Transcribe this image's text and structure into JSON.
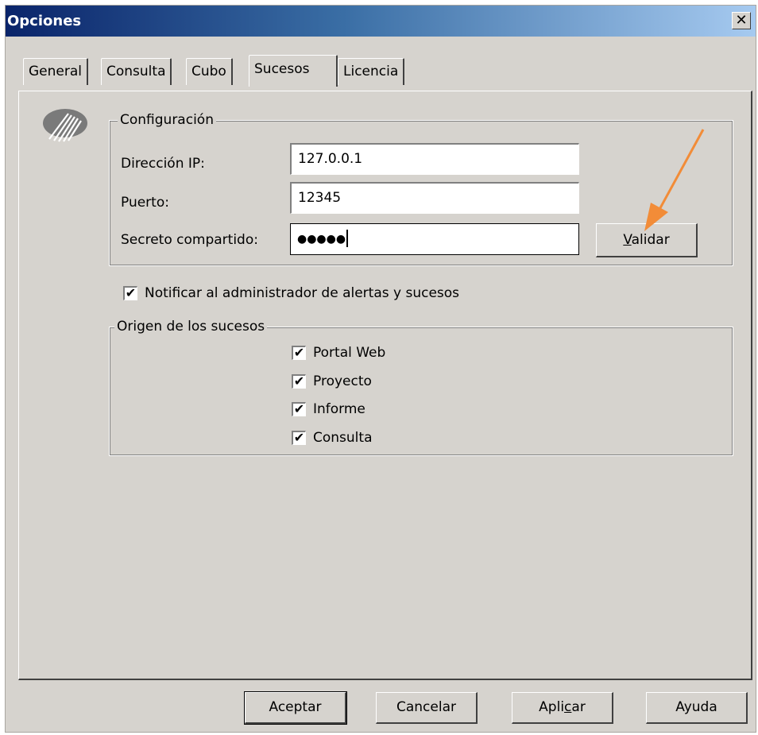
{
  "window": {
    "title": "Opciones",
    "close_glyph": "✕"
  },
  "tabs": [
    {
      "label": "General",
      "active": false
    },
    {
      "label": "Consulta",
      "active": false
    },
    {
      "label": "Cubo",
      "active": false
    },
    {
      "label": "Sucesos",
      "active": true
    },
    {
      "label": "Licencia",
      "active": false
    }
  ],
  "config": {
    "legend": "Configuración",
    "ip_label": "Dirección IP:",
    "ip_value": "127.0.0.1",
    "port_label": "Puerto:",
    "port_value": "12345",
    "secret_label": "Secreto compartido:",
    "secret_value": "●●●●●",
    "validate_prefix": "",
    "validate_mnemonic": "V",
    "validate_rest": "alidar"
  },
  "notify": {
    "label": "Notificar al administrador de alertas y sucesos",
    "checked": true
  },
  "sources": {
    "legend": "Origen de los sucesos",
    "items": [
      {
        "label": "Portal Web",
        "checked": true
      },
      {
        "label": "Proyecto",
        "checked": true
      },
      {
        "label": "Informe",
        "checked": true
      },
      {
        "label": "Consulta",
        "checked": true
      }
    ]
  },
  "buttons": {
    "ok": "Aceptar",
    "cancel": "Cancelar",
    "apply_prefix": "Apli",
    "apply_mnemonic": "c",
    "apply_rest": "ar",
    "help": "Ayuda"
  },
  "colors": {
    "annotation_arrow": "#f28c38",
    "title_gradient_start": "#0a246a"
  },
  "icons": {
    "logo": "product-logo-icon",
    "check": "checkmark-icon"
  }
}
